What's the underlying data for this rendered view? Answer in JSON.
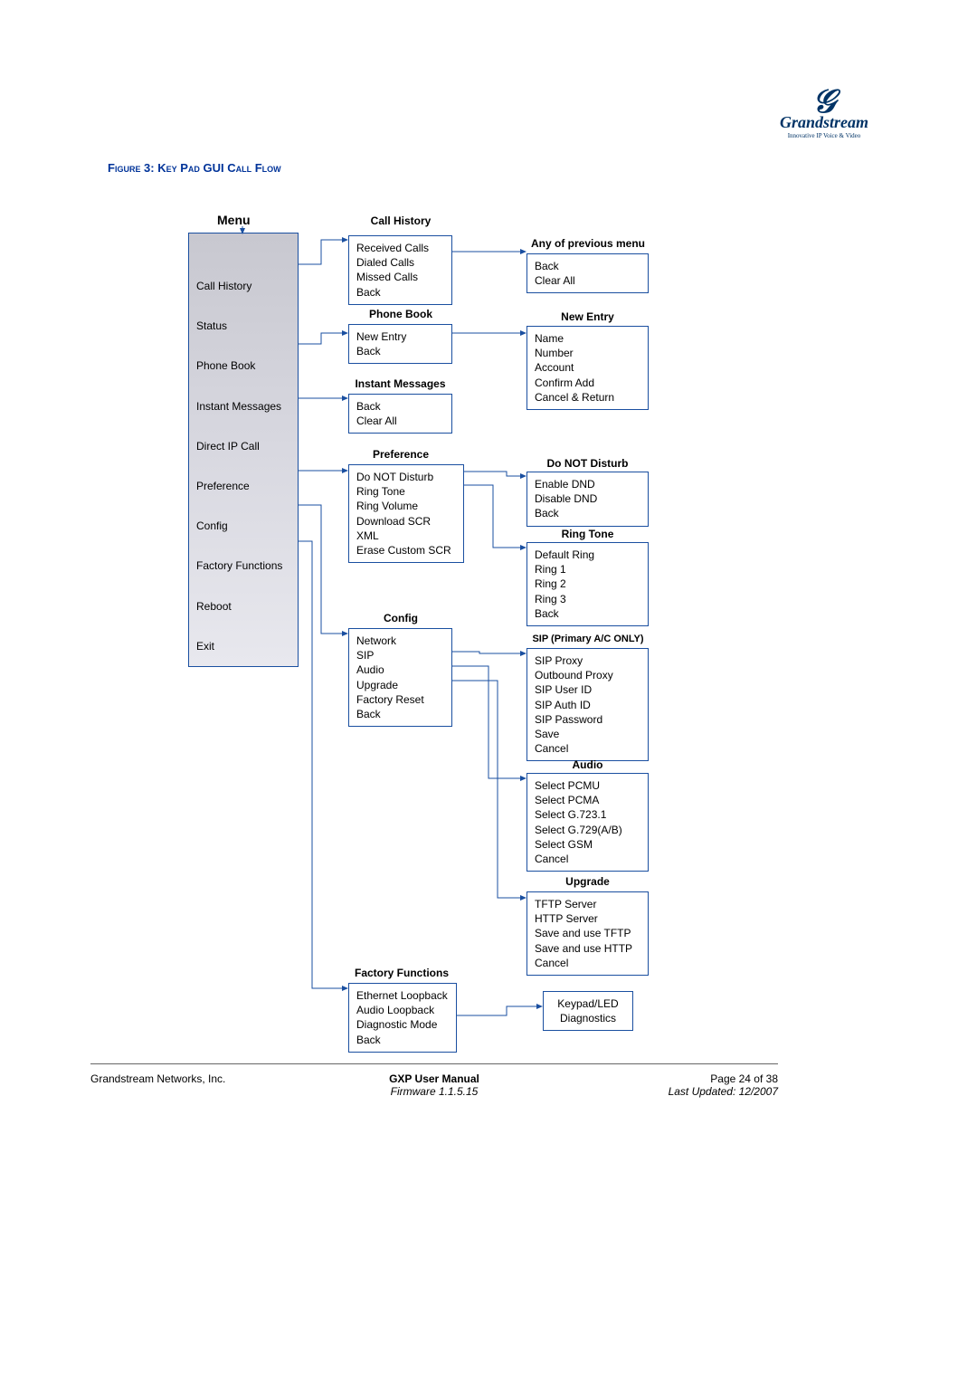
{
  "logo": {
    "brand": "Grandstream",
    "tagline": "Innovative IP Voice & Video"
  },
  "figure_caption": "Figure 3:  Key Pad GUI Call Flow",
  "main_menu_header": "Menu",
  "main_menu": {
    "items": [
      "Call History",
      "Status",
      "Phone Book",
      "Instant Messages",
      "Direct IP Call",
      "Preference",
      "Config",
      "Factory Functions",
      "Reboot",
      "Exit"
    ]
  },
  "call_history": {
    "header": "Call History",
    "items": [
      "Received Calls",
      "Dialed Calls",
      "Missed Calls",
      "Back"
    ]
  },
  "any_prev": {
    "header": "Any of previous menu",
    "items": [
      "Back",
      "Clear All"
    ]
  },
  "phone_book": {
    "header": "Phone Book",
    "items": [
      "New Entry",
      "Back"
    ]
  },
  "new_entry": {
    "header": "New Entry",
    "items": [
      "Name",
      "Number",
      "Account",
      "Confirm Add",
      "Cancel & Return"
    ]
  },
  "instant_messages": {
    "header": "Instant Messages",
    "items": [
      "Back",
      "Clear All"
    ]
  },
  "preference": {
    "header": "Preference",
    "items": [
      "Do NOT Disturb",
      "Ring Tone",
      "Ring Volume",
      "Download SCR XML",
      "Erase Custom SCR"
    ]
  },
  "dnd": {
    "header": "Do NOT Disturb",
    "items": [
      "Enable DND",
      "Disable DND",
      "Back"
    ]
  },
  "ring_tone": {
    "header": "Ring Tone",
    "items": [
      "Default Ring",
      "Ring 1",
      "Ring 2",
      "Ring 3",
      "Back"
    ]
  },
  "config": {
    "header": "Config",
    "items": [
      "Network",
      "SIP",
      "Audio",
      "Upgrade",
      "Factory Reset",
      "Back"
    ]
  },
  "sip": {
    "header": "SIP (Primary A/C ONLY)",
    "items": [
      "SIP Proxy",
      "Outbound Proxy",
      "SIP User ID",
      "SIP Auth ID",
      "SIP Password",
      "Save",
      "Cancel"
    ]
  },
  "audio": {
    "header": "Audio",
    "items": [
      "Select PCMU",
      "Select PCMA",
      "Select G.723.1",
      "Select G.729(A/B)",
      "Select GSM",
      "Cancel"
    ]
  },
  "upgrade": {
    "header": "Upgrade",
    "items": [
      "TFTP Server",
      "HTTP Server",
      "Save and use TFTP",
      "Save and use HTTP",
      "Cancel"
    ]
  },
  "factory_functions": {
    "header": "Factory Functions",
    "items": [
      "Ethernet Loopback",
      "Audio Loopback",
      "Diagnostic Mode",
      "Back"
    ]
  },
  "keypad_diag": {
    "items": [
      "Keypad/LED",
      "Diagnostics"
    ]
  },
  "footer": {
    "company": "Grandstream Networks, Inc.",
    "title": "GXP User Manual",
    "firmware": "Firmware 1.1.5.15",
    "page": "Page 24 of 38",
    "updated": "Last Updated:  12/2007"
  }
}
